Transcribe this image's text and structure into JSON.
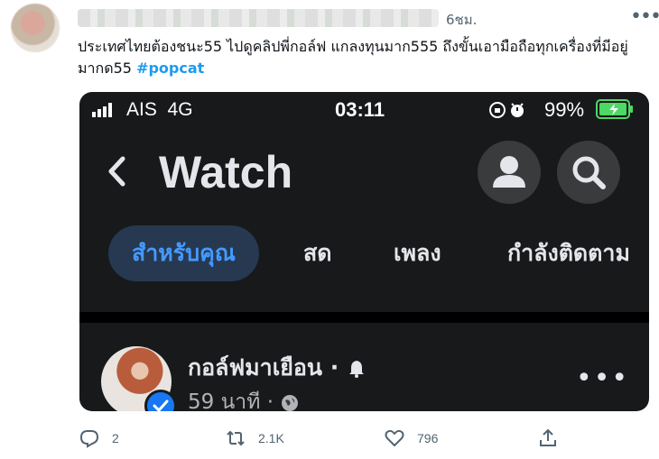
{
  "tweet": {
    "time": "6ชม.",
    "text": "ประเทศไทยต้องชนะ55 ไปดูคลิปพี่กอล์ฟ แกลงทุนมาก555 ถึงขั้นเอามือถือทุกเครื่องที่มีอยู่มากด55",
    "hashtag": "#popcat"
  },
  "phone": {
    "carrier": "AIS",
    "network": "4G",
    "clock": "03:11",
    "battery": "99%"
  },
  "watch": {
    "title": "Watch",
    "tabs": [
      "สำหรับคุณ",
      "สด",
      "เพลง",
      "กำลังติดตาม"
    ]
  },
  "post": {
    "author": "กอล์ฟมาเยือน",
    "time": "59 นาที"
  },
  "actions": {
    "replies": "2",
    "retweets": "2.1K",
    "likes": "796"
  },
  "icons": [
    "more-horizontal-icon",
    "signal-icon",
    "orientation-lock-icon",
    "alarm-icon",
    "battery-icon",
    "back-chevron-icon",
    "profile-icon",
    "search-icon",
    "verified-badge-icon",
    "bell-icon",
    "globe-icon",
    "reply-icon",
    "retweet-icon",
    "like-icon",
    "share-icon"
  ],
  "colors": {
    "hashtag": "#1d9bf0",
    "media_bg": "#18191a",
    "active_tab": "#4599ff",
    "battery_green": "#4cd964"
  }
}
